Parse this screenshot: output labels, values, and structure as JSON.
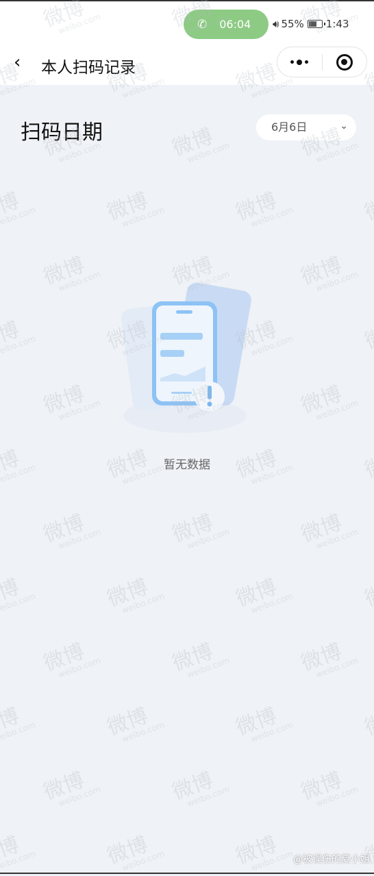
{
  "status_bar": {
    "call_time": "06:04",
    "battery": "55%",
    "time": "1:43"
  },
  "nav": {
    "back": "‹",
    "title": "本人扫码记录"
  },
  "header": {
    "title": "扫码日期",
    "date_select": "6月6日",
    "chevron": "⌄"
  },
  "empty_state": {
    "text": "暂无数据"
  },
  "watermark": {
    "logo": "微博",
    "domain": "weibo.com",
    "credit": "@被误伤的夏小姐"
  }
}
